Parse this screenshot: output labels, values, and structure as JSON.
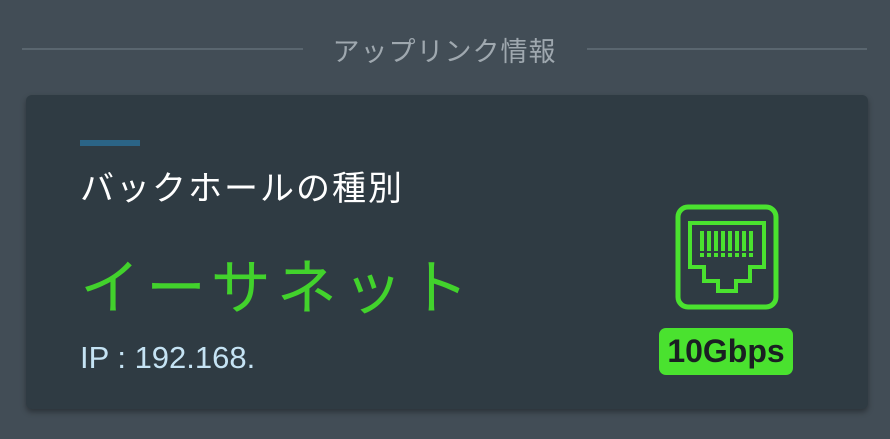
{
  "section": {
    "title": "アップリンク情報"
  },
  "backhaul": {
    "label": "バックホールの種別",
    "value": "イーサネット",
    "ip_line": "IP : 192.168.",
    "speed_badge": "10Gbps",
    "port_icon": "ethernet-port-icon"
  },
  "colors": {
    "background": "#424d56",
    "card": "#2f3b43",
    "accent_bar": "#2b6486",
    "value_green": "#42d22c",
    "badge_green": "#4ae22f",
    "ip_text": "#c5e3f4",
    "header_text": "#9fa8af"
  }
}
